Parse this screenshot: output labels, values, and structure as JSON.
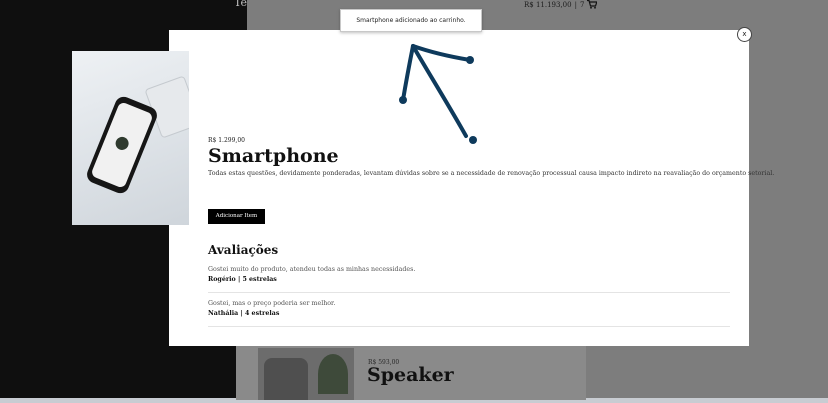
{
  "background": {
    "page_title_partial": "Te",
    "cart": {
      "total": "R$ 11.193,00",
      "separator": "|",
      "count": "7",
      "icon": "cart-icon"
    },
    "next_product": {
      "price": "R$ 593,00",
      "name": "Speaker"
    }
  },
  "toast": {
    "message": "Smartphone adicionado ao carrinho."
  },
  "modal": {
    "close_label": "x",
    "product": {
      "price": "R$ 1.299,00",
      "name": "Smartphone",
      "description": "Todas estas questões, devidamente ponderadas, levantam dúvidas sobre se a necessidade de renovação processual causa impacto indireto na reavaliação do orçamento setorial.",
      "add_button_label": "Adicionar Item"
    },
    "reviews": {
      "heading": "Avaliações",
      "items": [
        {
          "text": "Gostei muito do produto, atendeu todas as minhas necessidades.",
          "author": "Rogério",
          "separator": "|",
          "rating": "5 estrelas"
        },
        {
          "text": "Gostei, mas o preço poderia ser melhor.",
          "author": "Nathália",
          "separator": "|",
          "rating": "4 estrelas"
        }
      ]
    }
  },
  "colors": {
    "overlay_dark": "#0f0f0f",
    "overlay_gray": "#7d7d7d",
    "button_bg": "#000000",
    "annotation_arrow": "#0e3a5c"
  }
}
